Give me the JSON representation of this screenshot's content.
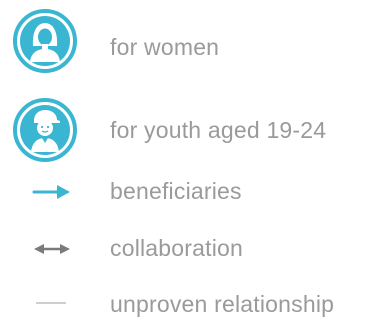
{
  "legend": {
    "items": [
      {
        "label": "for women",
        "icon": "woman-icon"
      },
      {
        "label": "for youth aged 19-24",
        "icon": "youth-icon"
      },
      {
        "label": "beneficiaries",
        "icon": "arrow-right-icon"
      },
      {
        "label": "collaboration",
        "icon": "double-arrow-icon"
      },
      {
        "label": "unproven relationship",
        "icon": "dash-line-icon"
      }
    ]
  },
  "colors": {
    "accent": "#3ab6d3",
    "text": "#9a9a9a",
    "neutral_arrow": "#7a7a7a",
    "faint_line": "#cfcfcf"
  }
}
